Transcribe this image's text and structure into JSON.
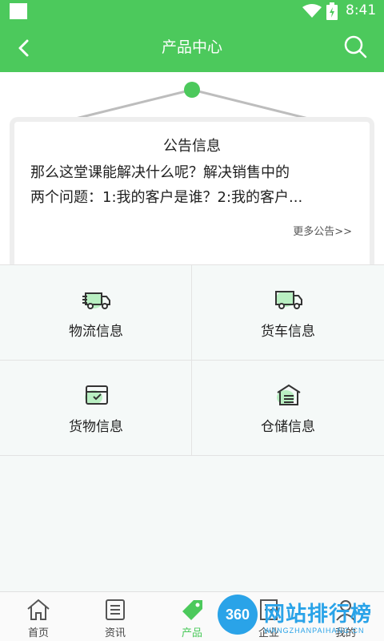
{
  "status_bar": {
    "time": "8:41"
  },
  "app_bar": {
    "title": "产品中心"
  },
  "notice": {
    "title": "公告信息",
    "lines": [
      "那么这堂课能解决什么呢？解决销售中的",
      "两个问题：1:我的客户是谁？2:我的客户..."
    ],
    "more": "更多公告>>"
  },
  "grid": [
    {
      "label": "物流信息",
      "icon": "logistics-truck-icon"
    },
    {
      "label": "货车信息",
      "icon": "truck-icon"
    },
    {
      "label": "货物信息",
      "icon": "cargo-box-icon"
    },
    {
      "label": "仓储信息",
      "icon": "warehouse-icon"
    }
  ],
  "tabs": [
    {
      "label": "首页",
      "icon": "home-icon"
    },
    {
      "label": "资讯",
      "icon": "news-icon"
    },
    {
      "label": "产品",
      "icon": "tag-icon"
    },
    {
      "label": "企业",
      "icon": "building-icon"
    },
    {
      "label": "我的",
      "icon": "user-icon"
    }
  ],
  "active_tab": 2,
  "watermark": {
    "badge": "360",
    "text": "网站排行榜",
    "sub": "WANGZHANPAIHANG.CN"
  },
  "colors": {
    "primary": "#4cc95c",
    "background": "#f5f9f8"
  }
}
